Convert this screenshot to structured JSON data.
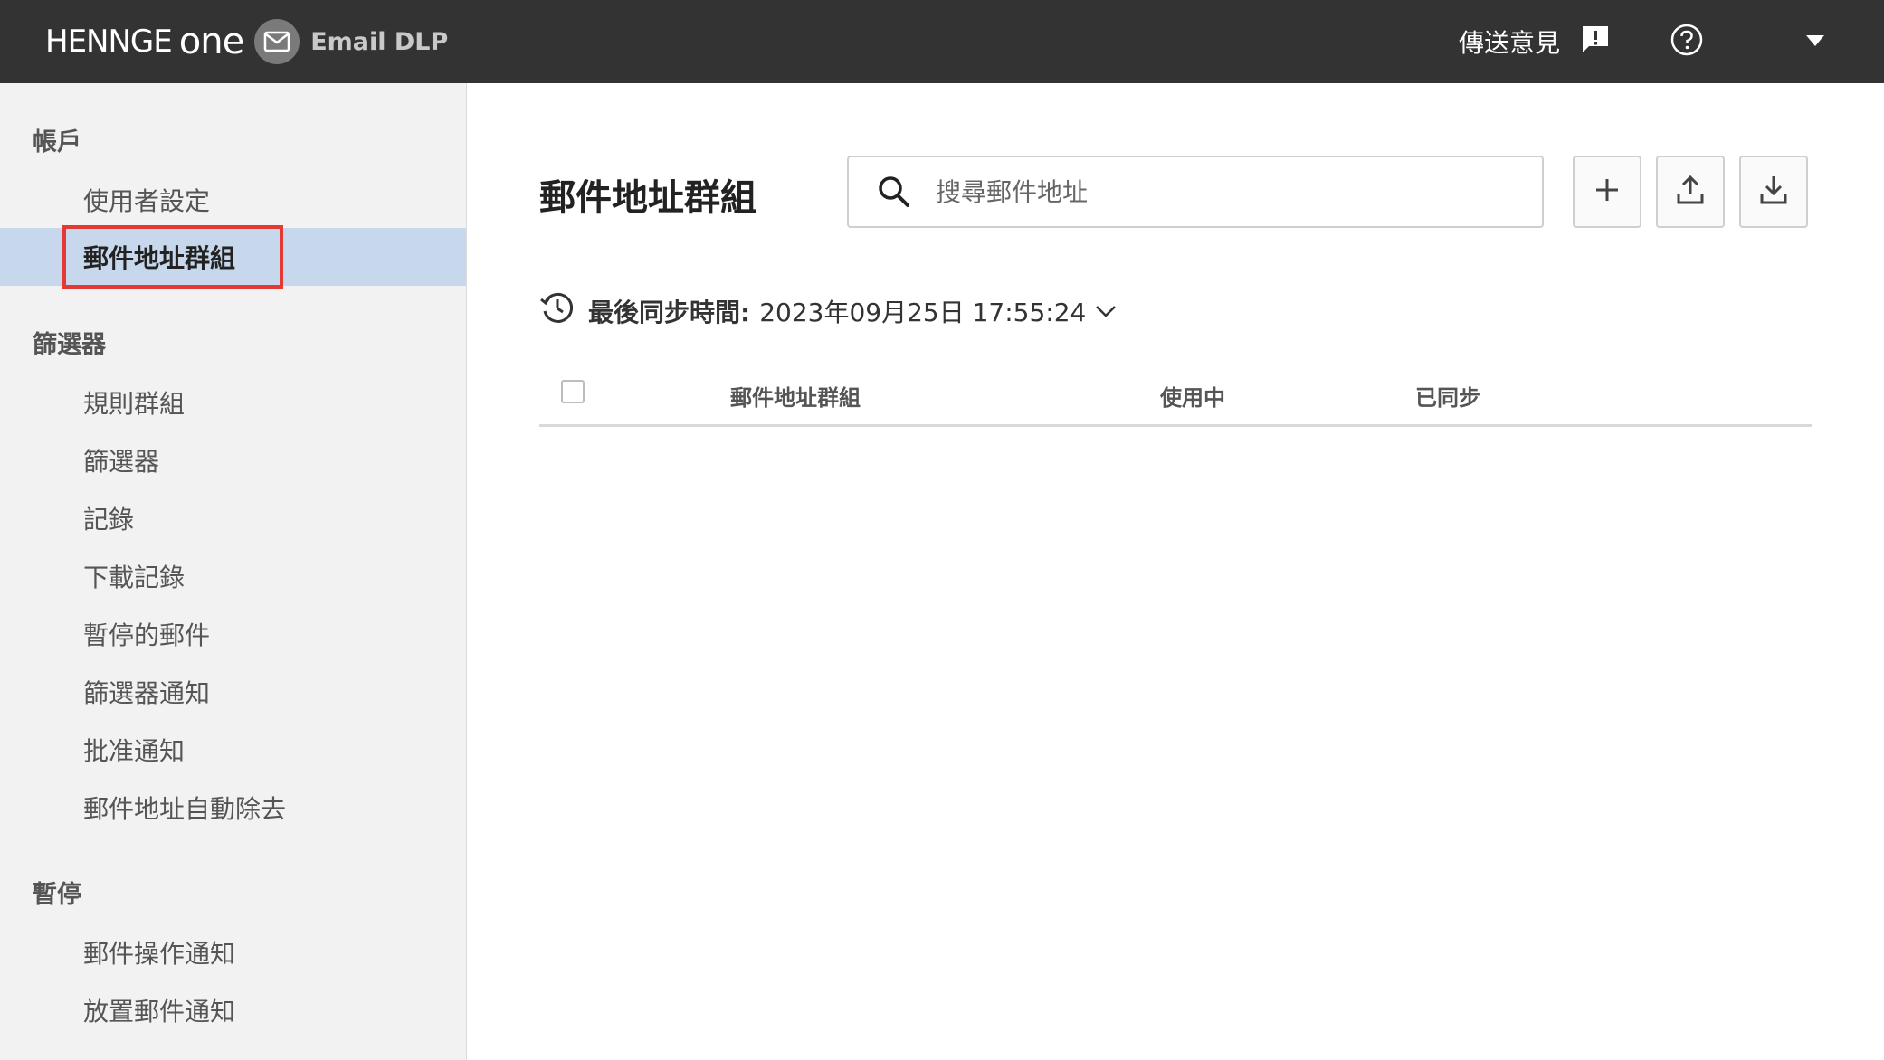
{
  "topbar": {
    "brand_word": "HENNGE",
    "brand_one": "one",
    "product": "Email DLP",
    "feedback_label": "傳送意見"
  },
  "sidebar": {
    "sections": [
      {
        "title": "帳戶",
        "items": [
          "使用者設定",
          "郵件地址群組"
        ]
      },
      {
        "title": "篩選器",
        "items": [
          "規則群組",
          "篩選器",
          "記錄",
          "下載記錄",
          "暫停的郵件",
          "篩選器通知",
          "批准通知",
          "郵件地址自動除去"
        ]
      },
      {
        "title": "暫停",
        "items": [
          "郵件操作通知",
          "放置郵件通知"
        ]
      }
    ],
    "active_item": "郵件地址群組"
  },
  "main": {
    "title": "郵件地址群組",
    "search": {
      "placeholder": "搜尋郵件地址",
      "value": ""
    },
    "sync": {
      "label": "最後同步時間:",
      "value": "2023年09月25日 17:55:24"
    },
    "table": {
      "columns": [
        "郵件地址群組",
        "使用中",
        "已同步"
      ],
      "rows": []
    }
  },
  "colors": {
    "topbar": "#333333",
    "sidebar_bg": "#f2f2f2",
    "active_bg": "#c8d8ec",
    "highlight_border": "#e53935"
  },
  "icons": {
    "mail": "mail-icon",
    "feedback": "feedback-icon",
    "help": "help-circle-icon",
    "menu": "caret-down-icon",
    "search": "search-icon",
    "add": "plus-icon",
    "upload": "upload-icon",
    "download": "download-icon",
    "sync": "sync-clock-icon"
  }
}
